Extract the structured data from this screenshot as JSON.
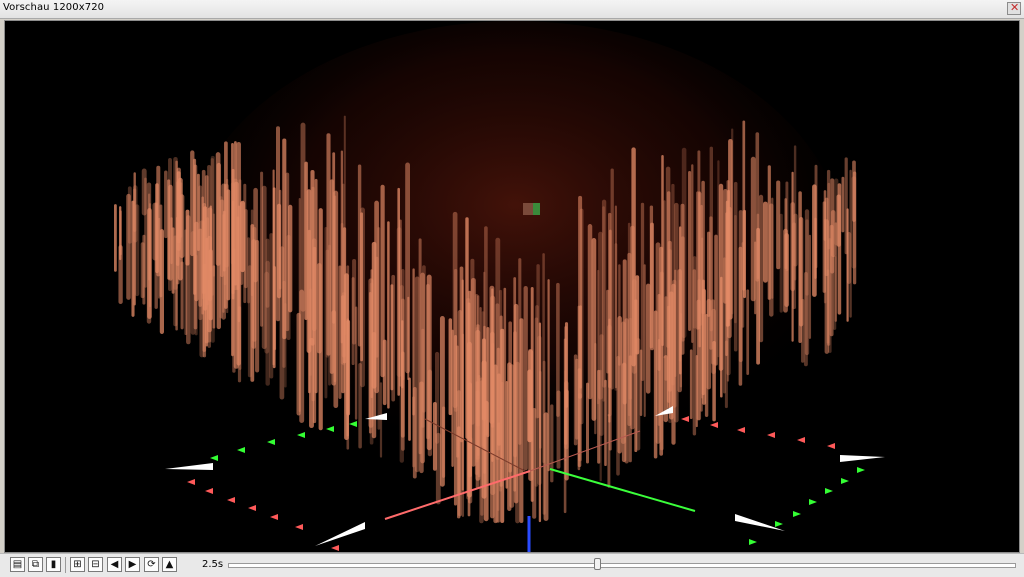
{
  "window": {
    "title": "Vorschau  1200x720",
    "close_glyph": "✕"
  },
  "preview": {
    "particle_color": "#e38a66",
    "background": "#000000",
    "axis_colors": {
      "x": "#ff6b6b",
      "y": "#3bff3b",
      "z": "#2a4bff"
    },
    "gizmo_markers": {
      "red": "#ff5a5a",
      "green": "#34ff34",
      "white": "#ffffff"
    }
  },
  "toolbar": {
    "buttons": [
      {
        "name": "export-frame-button",
        "glyph": "▤"
      },
      {
        "name": "copy-view-button",
        "glyph": "⧉"
      },
      {
        "name": "single-frame-button",
        "glyph": "▮"
      },
      {
        "name": "render-range-button",
        "glyph": "⊞"
      },
      {
        "name": "render-settings-button",
        "glyph": "⊟"
      },
      {
        "name": "previous-frame-button",
        "glyph": "◀"
      },
      {
        "name": "next-frame-button",
        "glyph": "▶"
      },
      {
        "name": "loop-button",
        "glyph": "⟳"
      },
      {
        "name": "bookmark-button",
        "glyph": "▲"
      }
    ],
    "time_label": "2.5s",
    "timeline_position": 0.47
  }
}
